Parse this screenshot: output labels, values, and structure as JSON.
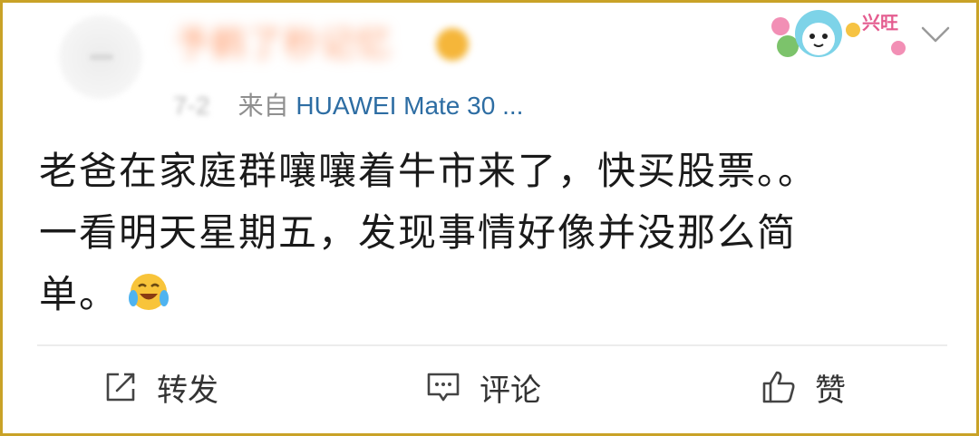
{
  "post": {
    "username": "予鹤了秒记忆",
    "meta": {
      "date": "7-2",
      "source_prefix": "来自",
      "source_device": "HUAWEI Mate 30 ..."
    },
    "sticker_text": "兴旺",
    "text_lines": [
      "老爸在家庭群嚷嚷着牛市来了，快买股票。。",
      "一看明天星期五，发现事情好像并没那么简",
      "单。"
    ]
  },
  "actions": {
    "repost": "转发",
    "comment": "评论",
    "like": "赞"
  },
  "icons": {
    "repost": "share-square-icon",
    "comment": "comment-bubble-icon",
    "like": "thumbs-up-icon",
    "emoji": "laughing-crying-emoji-icon",
    "menu": "chevron-down-icon"
  },
  "colors": {
    "border": "#c9a227",
    "source_link": "#2d6da3",
    "meta_gray": "#8f8f8f",
    "text": "#1a1a1a"
  }
}
